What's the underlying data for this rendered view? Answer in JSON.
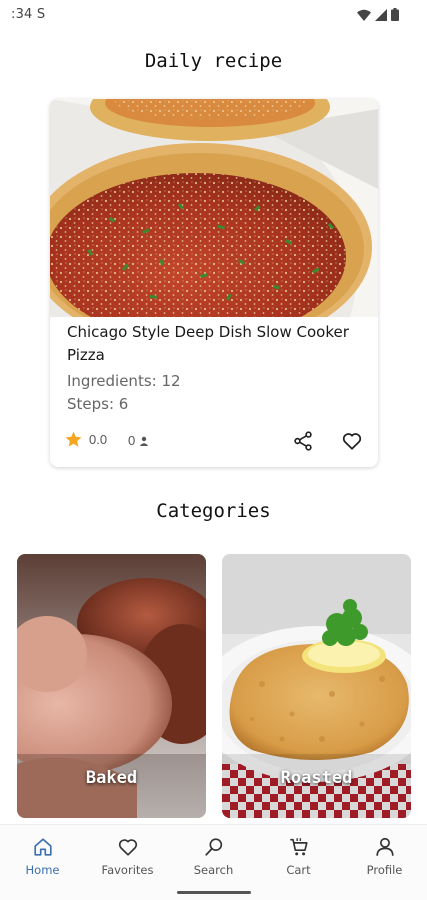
{
  "status_bar": {
    "time": ":34",
    "sim_glyph": "S",
    "icons": [
      "wifi-icon",
      "signal-icon",
      "battery-icon"
    ]
  },
  "daily": {
    "title": "Daily recipe",
    "recipe": {
      "name": "Chicago Style Deep Dish Slow Cooker Pizza",
      "ingredients": "Ingredients: 12",
      "steps": "Steps: 6",
      "rating": "0.0",
      "people_count": "0"
    }
  },
  "categories": {
    "title": "Categories",
    "items": [
      {
        "label": "Baked"
      },
      {
        "label": "Roasted"
      }
    ]
  },
  "nav": {
    "items": [
      {
        "label": "Home",
        "icon": "home-icon"
      },
      {
        "label": "Favorites",
        "icon": "heart-icon"
      },
      {
        "label": "Search",
        "icon": "search-icon"
      },
      {
        "label": "Cart",
        "icon": "cart-icon"
      },
      {
        "label": "Profile",
        "icon": "person-icon"
      }
    ]
  },
  "colors": {
    "accent": "#3a6fb0",
    "star": "#f5a623",
    "text_primary": "#1a1a1a",
    "text_secondary": "#666666"
  }
}
